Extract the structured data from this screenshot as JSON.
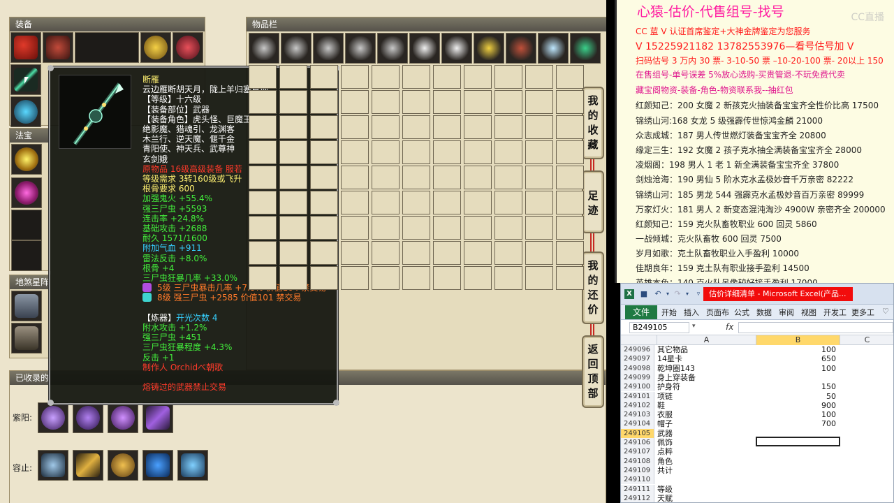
{
  "game": {
    "equip_panel_title": "装备",
    "items_panel_title": "物品栏",
    "fabao_title": "法宝",
    "disha_title": "地煞星阵",
    "collected_title": "已收录的",
    "row_labels": [
      "紫阳:",
      "容止:"
    ],
    "side_buttons": [
      {
        "chars": [
          "我",
          "的",
          "收",
          "藏"
        ]
      },
      {
        "chars": [
          "足",
          "迹"
        ]
      },
      {
        "chars": [
          "我",
          "的",
          "还",
          "价"
        ]
      },
      {
        "chars": [
          "返",
          "回",
          "顶",
          "部"
        ]
      }
    ]
  },
  "tooltip": {
    "lines": [
      {
        "text": "断雁",
        "color": "yellow"
      },
      {
        "text": "云边雁断胡天月，陇上羊归塞草烟。",
        "color": "white"
      },
      {
        "text": "【等级】十六级",
        "color": "white"
      },
      {
        "text": "【装备部位】武器",
        "color": "white"
      },
      {
        "text": "【装备角色】虎头怪、巨魔王",
        "color": "white"
      },
      {
        "text": "绝影魔、猎魂引、龙渊客",
        "color": "white"
      },
      {
        "text": "木兰行、逆天魔、偃千金",
        "color": "white"
      },
      {
        "text": "青阳使、神天兵、武尊神",
        "color": "white"
      },
      {
        "text": "玄剑娥",
        "color": "white"
      },
      {
        "text": "原物品 16级高级装备 服若",
        "color": "red"
      },
      {
        "text": "等级需求 3转160级或飞升",
        "color": "yellow"
      },
      {
        "text": "根骨要求 600",
        "color": "yellow"
      },
      {
        "text": "加强鬼火 +55.4%",
        "color": "green"
      },
      {
        "text": "强三尸虫 +5593",
        "color": "green"
      },
      {
        "text": "连击率 +24.8%",
        "color": "green"
      },
      {
        "text": "基础攻击 +2688",
        "color": "green"
      },
      {
        "text": "耐久 1571/1600",
        "color": "green"
      },
      {
        "text": "附加气血 +911",
        "color": "cyan"
      },
      {
        "text": "雷法反击 +8.0%",
        "color": "green"
      },
      {
        "text": "根骨 +4",
        "color": "green"
      },
      {
        "text": "三尸虫狂暴几率 +33.0%",
        "color": "green"
      },
      {
        "text": "5级 三尸虫暴击几率 +7.8% 价值104 禁交易",
        "color": "orange",
        "gem": "#b04ee0"
      },
      {
        "text": "8级 强三尸虫 +2585 价值101 禁交易",
        "color": "orange",
        "gem": "#3ed4d0"
      },
      {
        "text": "",
        "color": "white"
      },
      {
        "text": "【炼器】开光次数 4",
        "color": "yellow",
        "prefix": "【炼器】",
        "rest": "开光次数 4"
      },
      {
        "text": "附水攻击 +1.2%",
        "color": "green"
      },
      {
        "text": "强三尸虫 +451",
        "color": "green"
      },
      {
        "text": "三尸虫狂暴程度 +4.3%",
        "color": "green"
      },
      {
        "text": "反击 +1",
        "color": "green"
      },
      {
        "text": "制作人 Orchidべ朝歌",
        "color": "red"
      },
      {
        "text": "",
        "color": "white"
      },
      {
        "text": "熔铸过的武器禁止交易",
        "color": "red"
      }
    ]
  },
  "info": {
    "title": "心猿-估价-代售组号-找号",
    "lines": [
      {
        "text": "CC 蓝 V 认证首席鉴定+大神金牌鉴定为您服务",
        "style": "red"
      },
      {
        "text": "V 15225921182      13782553976—看号估号加 V",
        "style": "big"
      },
      {
        "text": "扫码估号 3 万内 30 票- 3-10-50 票  –10-20-100 票- 20以上 150",
        "style": "red"
      },
      {
        "text": "在售组号-单号误差 5%放心选购-买贵管退-不玩免费代卖",
        "style": "mag"
      },
      {
        "text": "藏宝阁物资-装备-角色-物资联系我--抽红包",
        "style": "mag"
      },
      {
        "text": "红颜知己：200 女魔 2 新孩克火抽装备宝宝齐全性价比高 17500",
        "style": "blk"
      },
      {
        "text": "锦绣山河:168 女龙 5 级强霹传世惊鸿金麟 21000",
        "style": "blk"
      },
      {
        "text": "众志成城：187 男人传世燃灯装备宝宝齐全 20800",
        "style": "blk"
      },
      {
        "text": "缘定三生：192 女魔 2 孩子克水抽全满装备宝宝齐全 28000",
        "style": "blk"
      },
      {
        "text": "凌烟阁：198 男人 1 老 1 新全满装备宝宝齐全 37800",
        "style": "blk"
      },
      {
        "text": "剑烛沧海：190 男仙 5 阶水克水孟极妙音千万亲密 82222",
        "style": "blk"
      },
      {
        "text": "锦绣山河：185 男龙 544 强霹克水孟极妙音百万亲密 89999",
        "style": "blk"
      },
      {
        "text": "万家灯火：181 男人 2 新变态混沌淘沙 4900W 亲密齐全 200000",
        "style": "blk"
      },
      {
        "text": "红颜知己：159 克火队畜牧职业 600 回灵 5860",
        "style": "blk"
      },
      {
        "text": "一战倾城：克火队畜牧 600 回灵 7500",
        "style": "blk"
      },
      {
        "text": "岁月如歌：克土队畜牧职业入手盈利 10000",
        "style": "blk"
      },
      {
        "text": "佳期良年：159 克土队有职业接手盈利 14500",
        "style": "blk"
      },
      {
        "text": "英雄本色：140 克火队吊像较好接手盈利 17000",
        "style": "blk"
      }
    ],
    "watermark": "CC直播"
  },
  "excel": {
    "logo": "X",
    "doc_title": "估价详细清单 - Microsoft Excel(产品...",
    "file_tab": "文件",
    "tabs": [
      "开始",
      "插入",
      "页面布",
      "公式",
      "数据",
      "审阅",
      "视图",
      "开发工",
      "更多工"
    ],
    "name_box": "B249105",
    "fx": "fx",
    "columns": [
      "A",
      "B",
      "C"
    ],
    "rows": [
      {
        "n": "249096",
        "a": "其它物品",
        "b": "100"
      },
      {
        "n": "249097",
        "a": "14星卡",
        "b": "650"
      },
      {
        "n": "249098",
        "a": "乾坤圈143",
        "b": "100"
      },
      {
        "n": "249099",
        "a": "身上穿装备",
        "b": ""
      },
      {
        "n": "249100",
        "a": "护身符",
        "b": "150"
      },
      {
        "n": "249101",
        "a": "项链",
        "b": "50"
      },
      {
        "n": "249102",
        "a": "鞋",
        "b": "900"
      },
      {
        "n": "249103",
        "a": "衣服",
        "b": "100"
      },
      {
        "n": "249104",
        "a": "帽子",
        "b": "700"
      },
      {
        "n": "249105",
        "a": "武器",
        "b": ""
      },
      {
        "n": "249106",
        "a": "佩饰",
        "b": ""
      },
      {
        "n": "249107",
        "a": "点粹",
        "b": ""
      },
      {
        "n": "249108",
        "a": "角色",
        "b": ""
      },
      {
        "n": "249109",
        "a": "共计",
        "b": ""
      },
      {
        "n": "249110",
        "a": "",
        "b": ""
      },
      {
        "n": "249111",
        "a": "等级",
        "b": ""
      },
      {
        "n": "249112",
        "a": "天赋",
        "b": ""
      }
    ]
  }
}
